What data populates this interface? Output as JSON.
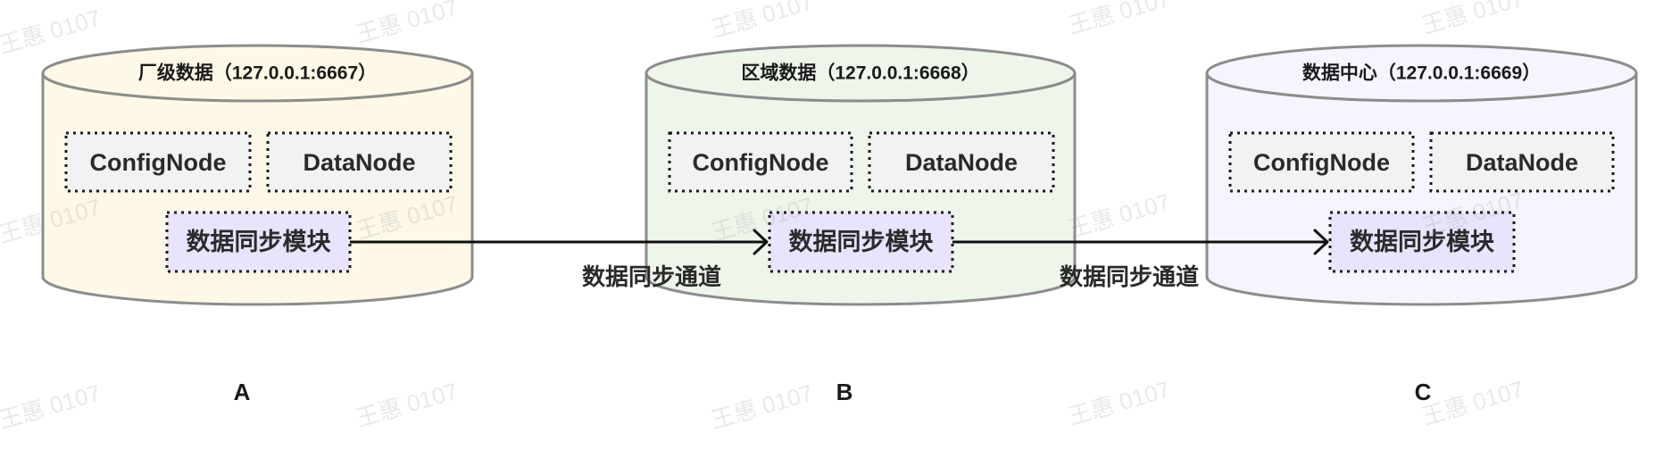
{
  "watermark": "王惠 0107",
  "colors": {
    "stroke": "#8c8c8c",
    "component_fill": "#f2f2f2",
    "sync_module_fill": "#e9e3fb",
    "arrow": "#111111"
  },
  "nodes": [
    {
      "label": "A",
      "title": "厂级数据（127.0.0.1:6667）",
      "config_node": "ConfigNode",
      "data_node": "DataNode",
      "sync_module": "数据同步模块",
      "fill": "#fdf8e7"
    },
    {
      "label": "B",
      "title": "区域数据（127.0.0.1:6668）",
      "config_node": "ConfigNode",
      "data_node": "DataNode",
      "sync_module": "数据同步模块",
      "fill": "#eef6ec"
    },
    {
      "label": "C",
      "title": "数据中心（127.0.0.1:6669）",
      "config_node": "ConfigNode",
      "data_node": "DataNode",
      "sync_module": "数据同步模块",
      "fill": "#f5f6fd"
    }
  ],
  "channels": [
    {
      "label": "数据同步通道"
    },
    {
      "label": "数据同步通道"
    }
  ]
}
